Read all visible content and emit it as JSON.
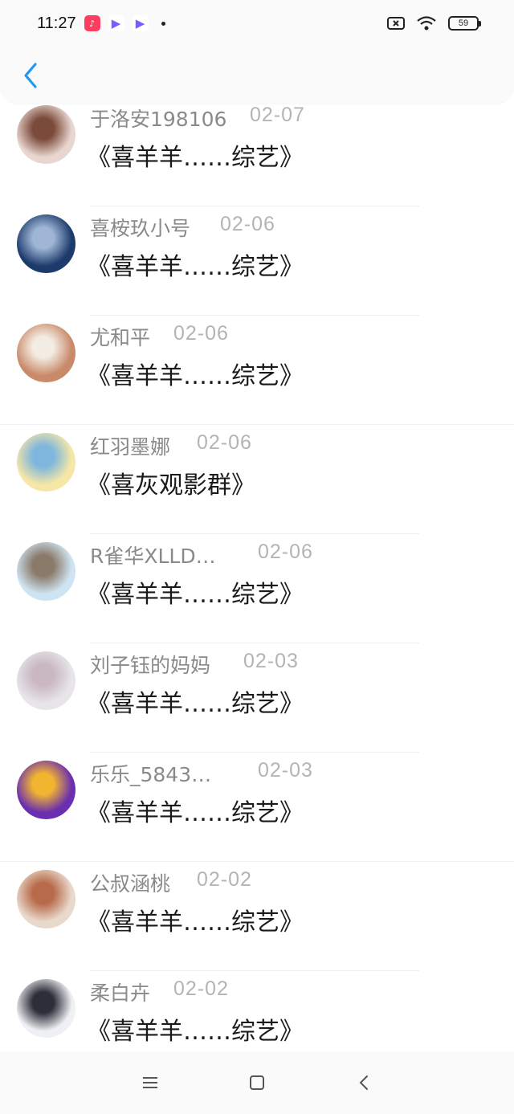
{
  "status_bar": {
    "time": "11:27",
    "battery": "59"
  },
  "header": {
    "back_icon": "chevron-left-icon",
    "accent_color": "#1e9bf0"
  },
  "list": [
    {
      "name": "于洛安198106",
      "date": "02-07",
      "title": "《喜羊羊……综艺》",
      "avatar_colors": [
        "#e9d6d0",
        "#7a4a3a"
      ]
    },
    {
      "name": "喜桉玖小号",
      "date": "02-06",
      "title": "《喜羊羊……综艺》",
      "avatar_colors": [
        "#1d3a6b",
        "#9fb6d6"
      ]
    },
    {
      "name": "尤和平",
      "date": "02-06",
      "title": "《喜羊羊……综艺》",
      "avatar_colors": [
        "#c98a6a",
        "#f3ece2"
      ]
    },
    {
      "name": "红羽墨娜",
      "date": "02-06",
      "title": "《喜灰观影群》",
      "avatar_colors": [
        "#f6e7a7",
        "#7fb6dd"
      ]
    },
    {
      "name": "R雀华XLLD…",
      "date": "02-06",
      "title": "《喜羊羊……综艺》",
      "avatar_colors": [
        "#cfe4f2",
        "#8a7a6a"
      ]
    },
    {
      "name": "刘子钰的妈妈",
      "date": "02-03",
      "title": "《喜羊羊……综艺》",
      "avatar_colors": [
        "#e8e4ea",
        "#c9b8c2"
      ]
    },
    {
      "name": "乐乐_5843…",
      "date": "02-03",
      "title": "《喜羊羊……综艺》",
      "avatar_colors": [
        "#6a2fb0",
        "#f2b530"
      ]
    },
    {
      "name": "公叔涵桃",
      "date": "02-02",
      "title": "《喜羊羊……综艺》",
      "avatar_colors": [
        "#e9d9cc",
        "#b86b4a"
      ]
    },
    {
      "name": "柔白卉",
      "date": "02-02",
      "title": "《喜羊羊……综艺》",
      "avatar_colors": [
        "#eef0f3",
        "#2e2e3a"
      ]
    }
  ],
  "nav_bar": {
    "menu_icon": "menu-icon",
    "home_icon": "home-square-icon",
    "back_icon": "back-triangle-icon"
  }
}
